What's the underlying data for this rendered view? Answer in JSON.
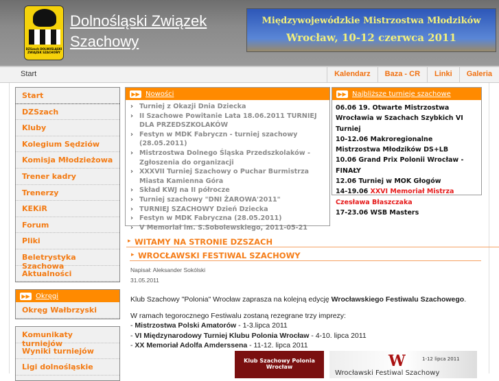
{
  "header": {
    "site_title": "Dolnośląski Związek Szachowy",
    "logo_text": "DZSzach DOLNOŚLĄSKI ZWIĄZEK SZACHOWY",
    "banner_line1": "Międzywojewódzkie Mistrzostwa Młodzików",
    "banner_line2": "Wrocław, 10-12 czerwca 2011"
  },
  "nav": {
    "breadcrumb": "Start",
    "links": [
      "Kalendarz",
      "Baza - CR",
      "Linki",
      "Galeria"
    ]
  },
  "menu": [
    "Start",
    "DZSzach",
    "Kluby",
    "Kolegium Sędziów",
    "Komisja Młodzieżowa",
    "Trener kadry",
    "Trenerzy",
    "KEKiR",
    "Forum",
    "Pliki",
    "Beletrystyka Szachowa",
    "Aktualności"
  ],
  "okregi": {
    "title": "Okręgi",
    "items": [
      "Okręg Wałbrzyski"
    ]
  },
  "menu3": [
    "Komunikaty turniejów",
    "Wyniki turniejów",
    "Ligi dolnośląskie"
  ],
  "news": {
    "title": "Nowości",
    "items": [
      "Turniej z Okazji Dnia Dziecka",
      "II Szachowe Powitanie Lata 18.06.2011 TURNIEJ DLA PRZEDSZKOLAKÓW",
      "Festyn w MDK Fabryczn - turniej szachowy (28.05.2011)",
      "Mistrzostwa Dolnego Śląska Przedszkolaków - Zgłoszenia do organizacji",
      "XXXVII Turniej Szachowy o Puchar Burmistrza Miasta Kamienna Góra",
      "Skład KWJ na II półrocze",
      "Turniej szachowy \"DNI ŻAROWA'2011\"",
      "TURNIEJ SZACHOWY Dzień Dziecka",
      "Festyn w MDK Fabryczna (28.05.2011)",
      "V Memoriał im. S.Sobolewskiego, 2011-05-21"
    ]
  },
  "upcoming": {
    "title": "Najbliższe turnieje szachowe",
    "items": [
      "06.06 19. Otwarte Mistrzostwa Wrocławia w Szachach Szybkich VI Turniej",
      "10-12.06 Makroregionalne Mistrzostwa Młodzików DS+LB",
      "10.06 Grand Prix Polonii Wrocław - FINAŁY",
      "12.06 Turniej w MOK Głogów"
    ],
    "highlight_date": "14-19.06",
    "highlight_text": "XXVI Memoriał Mistrza Czesława Błaszczaka",
    "last": "17-23.06 WSB Masters"
  },
  "welcome": "WITAMY NA STRONIE DZSZACH",
  "article": {
    "title": "WROCŁAWSKI FESTIWAL SZACHOWY",
    "author": "Napisał: Aleksander Sokólski",
    "date": "31.05.2011",
    "p1a": "Klub Szachowy \"Polonia\" Wrocław zaprasza na kolejną edycję ",
    "p1b": "Wrocławskiego Festiwalu Szachowego",
    "p1c": ".",
    "p2": "W ramach tegorocznego Festiwalu zostaną rezegrane trzy imprezy:",
    "events": [
      {
        "name": "Mistrzostwa Polski Amatorów",
        "date": " - 1-3.lipca 2011"
      },
      {
        "name": "VI Międzynarodowy Turniej Klubu Polonia Wrocław",
        "date": " - 4-10. lipca 2011"
      },
      {
        "name": "XX Memoriał Adolfa Amderssena",
        "date": " - 11-12. lipca 2011"
      }
    ],
    "img1_text": "Klub Szachowy Polonia Wrocław",
    "img2_letter": "W",
    "img2_date": "1-12 lipca 2011",
    "img2_title": "Wrocławski Festiwal Szachowy"
  }
}
